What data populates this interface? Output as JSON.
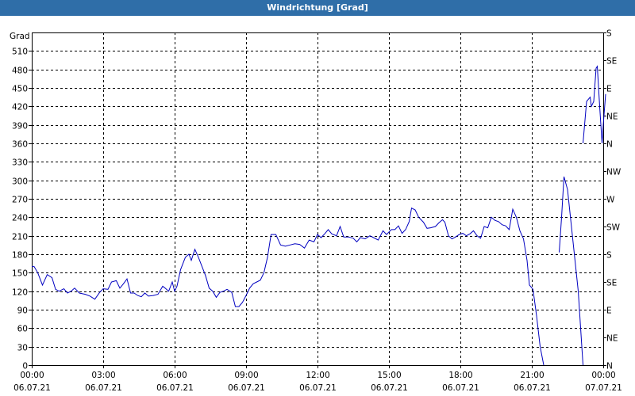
{
  "window": {
    "title": "Windrichtung [Grad]"
  },
  "chart_data": {
    "type": "line",
    "title": "Windrichtung [Grad]",
    "ylabel": "Grad",
    "xlabel": "",
    "ylim": [
      0,
      540
    ],
    "y_ticks": [
      0,
      30,
      60,
      90,
      120,
      150,
      180,
      210,
      240,
      270,
      300,
      330,
      360,
      390,
      420,
      450,
      480,
      510
    ],
    "y_right_ticks": [
      {
        "value": 0,
        "label": "N"
      },
      {
        "value": 45,
        "label": "NE"
      },
      {
        "value": 90,
        "label": "E"
      },
      {
        "value": 135,
        "label": "SE"
      },
      {
        "value": 180,
        "label": "S"
      },
      {
        "value": 225,
        "label": "SW"
      },
      {
        "value": 270,
        "label": "W"
      },
      {
        "value": 315,
        "label": "NW"
      },
      {
        "value": 360,
        "label": "N"
      },
      {
        "value": 405,
        "label": "NE"
      },
      {
        "value": 450,
        "label": "E"
      },
      {
        "value": 495,
        "label": "SE"
      },
      {
        "value": 540,
        "label": "S"
      }
    ],
    "xlim": [
      0,
      24
    ],
    "x_ticks": [
      {
        "value": 0,
        "time": "00:00",
        "date": "06.07.21"
      },
      {
        "value": 3,
        "time": "03:00",
        "date": "06.07.21"
      },
      {
        "value": 6,
        "time": "06:00",
        "date": "06.07.21"
      },
      {
        "value": 9,
        "time": "09:00",
        "date": "06.07.21"
      },
      {
        "value": 12,
        "time": "12:00",
        "date": "06.07.21"
      },
      {
        "value": 15,
        "time": "15:00",
        "date": "06.07.21"
      },
      {
        "value": 18,
        "time": "18:00",
        "date": "06.07.21"
      },
      {
        "value": 21,
        "time": "21:00",
        "date": "06.07.21"
      },
      {
        "value": 24,
        "time": "00:00",
        "date": "07.07.21"
      }
    ],
    "grid": true,
    "series": [
      {
        "color": "#0000c0",
        "segments": [
          [
            [
              0,
              160
            ],
            [
              0.1,
              160
            ],
            [
              0.25,
              150
            ],
            [
              0.45,
              130
            ],
            [
              0.65,
              147
            ],
            [
              0.85,
              142
            ],
            [
              1.0,
              123
            ],
            [
              1.15,
              120
            ],
            [
              1.35,
              124
            ],
            [
              1.5,
              117
            ],
            [
              1.65,
              120
            ],
            [
              1.8,
              125
            ],
            [
              2.0,
              117
            ],
            [
              2.25,
              115
            ],
            [
              2.45,
              112
            ],
            [
              2.65,
              107
            ],
            [
              2.85,
              118
            ],
            [
              3.0,
              124
            ],
            [
              3.2,
              123
            ],
            [
              3.35,
              135
            ],
            [
              3.55,
              137
            ],
            [
              3.7,
              125
            ],
            [
              3.85,
              132
            ],
            [
              4.0,
              140
            ],
            [
              4.15,
              117
            ],
            [
              4.3,
              117
            ],
            [
              4.45,
              113
            ],
            [
              4.6,
              111
            ],
            [
              4.75,
              117
            ],
            [
              4.9,
              112
            ],
            [
              5.1,
              113
            ],
            [
              5.3,
              115
            ],
            [
              5.5,
              128
            ],
            [
              5.6,
              125
            ],
            [
              5.75,
              120
            ],
            [
              5.9,
              135
            ],
            [
              6.0,
              120
            ],
            [
              6.1,
              128
            ],
            [
              6.25,
              155
            ],
            [
              6.45,
              175
            ],
            [
              6.6,
              180
            ],
            [
              6.7,
              170
            ],
            [
              6.85,
              188
            ],
            [
              7.0,
              175
            ],
            [
              7.15,
              160
            ],
            [
              7.3,
              145
            ],
            [
              7.45,
              125
            ],
            [
              7.6,
              120
            ],
            [
              7.75,
              110
            ],
            [
              7.9,
              118
            ],
            [
              8.05,
              120
            ],
            [
              8.2,
              123
            ],
            [
              8.4,
              118
            ],
            [
              8.55,
              95
            ],
            [
              8.7,
              95
            ],
            [
              8.85,
              102
            ],
            [
              9.0,
              113
            ],
            [
              9.15,
              125
            ],
            [
              9.3,
              132
            ],
            [
              9.45,
              135
            ],
            [
              9.6,
              138
            ],
            [
              9.75,
              150
            ],
            [
              9.9,
              175
            ],
            [
              10.05,
              212
            ],
            [
              10.25,
              212
            ],
            [
              10.45,
              195
            ],
            [
              10.65,
              193
            ],
            [
              10.85,
              195
            ],
            [
              11.05,
              197
            ],
            [
              11.25,
              196
            ],
            [
              11.45,
              190
            ],
            [
              11.65,
              203
            ],
            [
              11.85,
              200
            ],
            [
              12.0,
              212
            ],
            [
              12.15,
              207
            ],
            [
              12.3,
              213
            ],
            [
              12.45,
              220
            ],
            [
              12.6,
              213
            ],
            [
              12.8,
              210
            ],
            [
              12.95,
              225
            ],
            [
              13.1,
              208
            ],
            [
              13.3,
              208
            ],
            [
              13.5,
              206
            ],
            [
              13.65,
              200
            ],
            [
              13.8,
              207
            ],
            [
              14.0,
              205
            ],
            [
              14.2,
              210
            ],
            [
              14.35,
              207
            ],
            [
              14.55,
              203
            ],
            [
              14.75,
              218
            ],
            [
              14.9,
              212
            ],
            [
              15.1,
              220
            ],
            [
              15.25,
              220
            ],
            [
              15.4,
              226
            ],
            [
              15.55,
              214
            ],
            [
              15.7,
              220
            ],
            [
              15.85,
              233
            ],
            [
              15.95,
              255
            ],
            [
              16.1,
              252
            ],
            [
              16.25,
              240
            ],
            [
              16.45,
              232
            ],
            [
              16.6,
              222
            ],
            [
              16.75,
              223
            ],
            [
              16.95,
              225
            ],
            [
              17.1,
              231
            ],
            [
              17.25,
              236
            ],
            [
              17.35,
              232
            ],
            [
              17.5,
              210
            ],
            [
              17.65,
              205
            ],
            [
              17.8,
              208
            ],
            [
              17.95,
              212
            ],
            [
              18.1,
              214
            ],
            [
              18.25,
              210
            ],
            [
              18.4,
              213
            ],
            [
              18.55,
              218
            ],
            [
              18.7,
              210
            ],
            [
              18.85,
              206
            ],
            [
              19.0,
              225
            ],
            [
              19.15,
              223
            ],
            [
              19.3,
              240
            ],
            [
              19.45,
              235
            ],
            [
              19.6,
              233
            ],
            [
              19.75,
              228
            ],
            [
              19.9,
              226
            ],
            [
              20.05,
              220
            ],
            [
              20.2,
              253
            ],
            [
              20.35,
              240
            ],
            [
              20.5,
              218
            ],
            [
              20.65,
              205
            ],
            [
              20.8,
              170
            ],
            [
              20.9,
              130
            ],
            [
              21.05,
              123
            ],
            [
              21.2,
              80
            ],
            [
              21.35,
              30
            ],
            [
              21.5,
              0
            ]
          ],
          [
            [
              22.15,
              183
            ],
            [
              22.25,
              240
            ],
            [
              22.35,
              306
            ],
            [
              22.5,
              285
            ],
            [
              22.65,
              230
            ],
            [
              22.8,
              175
            ],
            [
              22.95,
              120
            ],
            [
              23.05,
              60
            ],
            [
              23.15,
              0
            ]
          ],
          [
            [
              23.15,
              360
            ],
            [
              23.3,
              428
            ],
            [
              23.45,
              435
            ],
            [
              23.5,
              420
            ],
            [
              23.6,
              428
            ],
            [
              23.7,
              482
            ],
            [
              23.75,
              485
            ],
            [
              23.85,
              420
            ],
            [
              23.95,
              360
            ],
            [
              24.0,
              390
            ],
            [
              24.1,
              440
            ]
          ]
        ]
      }
    ]
  }
}
